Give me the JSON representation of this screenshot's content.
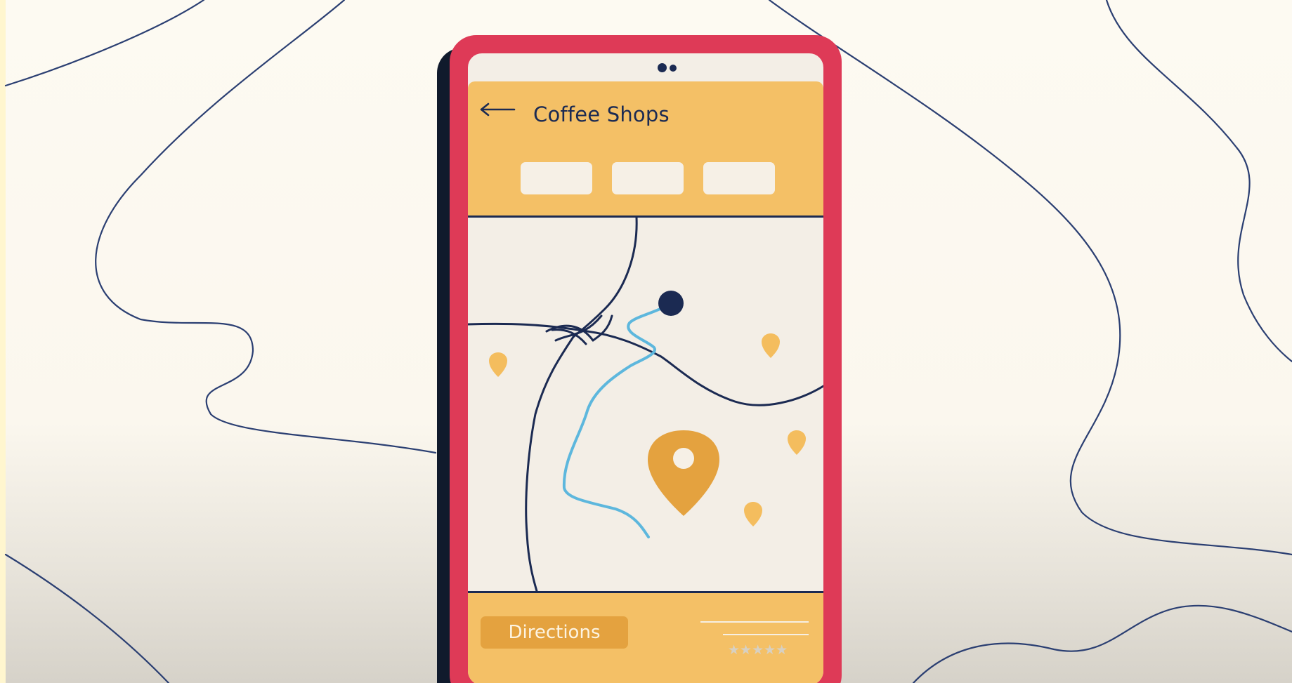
{
  "header": {
    "back_icon": "arrow-left-icon",
    "title": "Coffee Shops",
    "filters": [
      "",
      "",
      ""
    ]
  },
  "map": {
    "route_start_icon": "location-dot-icon",
    "selected_pin_icon": "map-pin-icon",
    "poi_pin_icon": "map-pin-small-icon"
  },
  "footer": {
    "directions_label": "Directions",
    "rating": "★★★★★"
  },
  "colors": {
    "background": "#fdfaf2",
    "phone_frame": "#de3a57",
    "panel": "#f4c066",
    "accent_pin": "#e4a23f",
    "road": "#1b2a52",
    "route": "#5db7dd"
  }
}
